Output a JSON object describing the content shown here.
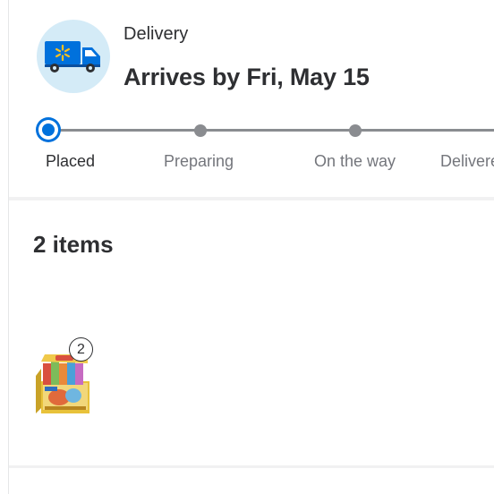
{
  "delivery": {
    "label": "Delivery",
    "arrival_text": "Arrives by Fri, May 15",
    "icon": "delivery-truck-icon"
  },
  "tracker": {
    "steps": [
      {
        "label": "Placed",
        "state": "active"
      },
      {
        "label": "Preparing",
        "state": "pending"
      },
      {
        "label": "On the way",
        "state": "pending"
      },
      {
        "label": "Delivered",
        "state": "pending"
      }
    ]
  },
  "items": {
    "title": "2 items",
    "list": [
      {
        "quantity": "2",
        "image": "trading-card-booster-box"
      }
    ]
  },
  "colors": {
    "accent": "#0071dc",
    "truck_circle": "#d4ebf7",
    "track_gray": "#8a8c90",
    "text_primary": "#2e2f32",
    "text_secondary": "#74767c"
  }
}
